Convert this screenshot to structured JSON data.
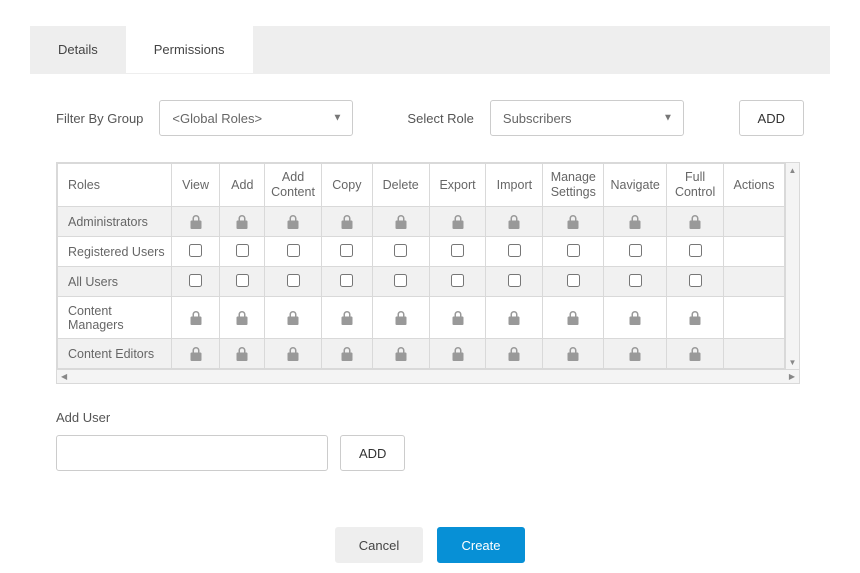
{
  "tabs": {
    "details": "Details",
    "permissions": "Permissions"
  },
  "filter": {
    "group_label": "Filter By Group",
    "group_value": "<Global Roles>",
    "role_label": "Select Role",
    "role_value": "Subscribers",
    "add_button": "ADD"
  },
  "grid": {
    "headers": {
      "roles": "Roles",
      "view": "View",
      "add": "Add",
      "add_content": "Add Content",
      "copy": "Copy",
      "delete": "Delete",
      "export": "Export",
      "import": "Import",
      "manage_settings": "Manage Settings",
      "navigate": "Navigate",
      "full_control": "Full Control",
      "actions": "Actions"
    },
    "rows": [
      {
        "name": "Administrators",
        "type": "locked",
        "shaded": true,
        "tall": false
      },
      {
        "name": "Registered Users",
        "type": "checkbox",
        "shaded": false,
        "tall": false
      },
      {
        "name": "All Users",
        "type": "checkbox",
        "shaded": true,
        "tall": false
      },
      {
        "name": "Content Managers",
        "type": "locked",
        "shaded": false,
        "tall": true
      },
      {
        "name": "Content Editors",
        "type": "locked",
        "shaded": true,
        "tall": false
      }
    ]
  },
  "add_user": {
    "label": "Add User",
    "button": "ADD"
  },
  "footer": {
    "cancel": "Cancel",
    "create": "Create"
  },
  "icons": {
    "lock_color": "#999999"
  }
}
